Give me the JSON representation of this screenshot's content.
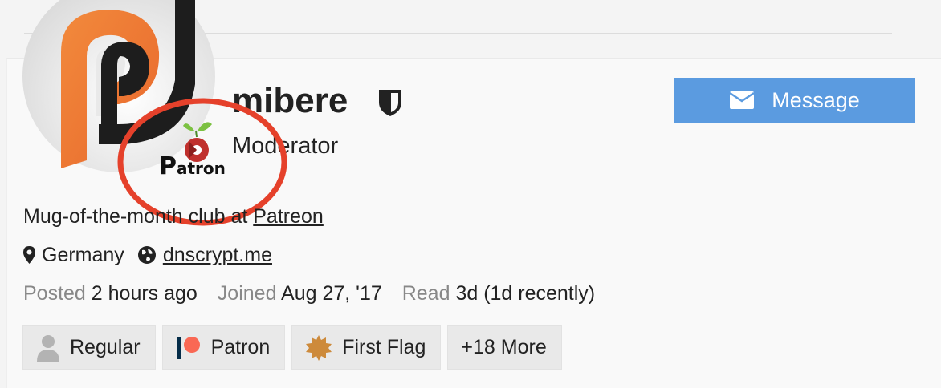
{
  "user": {
    "username": "mibere",
    "title": "Moderator",
    "bio_prefix": "Mug-of-the-month club at ",
    "bio_link": "Patreon",
    "location": "Germany",
    "website": "dnscrypt.me"
  },
  "actions": {
    "message_label": "Message"
  },
  "stats": {
    "posted_label": "Posted",
    "posted_value": "2 hours ago",
    "joined_label": "Joined",
    "joined_value": "Aug 27, '17",
    "read_label": "Read",
    "read_value": "3d (1d recently)"
  },
  "patron_overlay": {
    "text_initial": "P",
    "text_rest": "atron"
  },
  "badges": [
    {
      "label": "Regular",
      "icon": "user-icon"
    },
    {
      "label": "Patron",
      "icon": "patreon-icon"
    },
    {
      "label": "First Flag",
      "icon": "flag-badge-icon"
    },
    {
      "label": "+18 More",
      "icon": ""
    }
  ],
  "colors": {
    "accent": "#5b9be0",
    "highlight_circle": "#e5412b",
    "avatar_orange": "#ef7d3a"
  }
}
